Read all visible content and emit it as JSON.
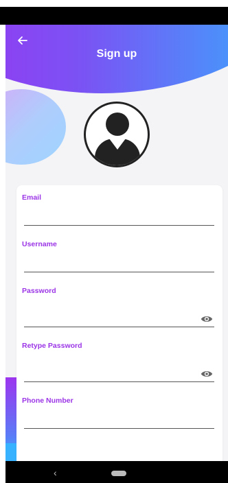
{
  "header": {
    "title": "Sign up",
    "back_icon": "arrow-left-icon"
  },
  "form": {
    "fields": [
      {
        "label": "Email",
        "value": "",
        "type": "email"
      },
      {
        "label": "Username",
        "value": "",
        "type": "text"
      },
      {
        "label": "Password",
        "value": "",
        "type": "password",
        "icon": "eye-icon"
      },
      {
        "label": "Retype Password",
        "value": "",
        "type": "password",
        "icon": "eye-icon"
      },
      {
        "label": "Phone Number",
        "value": "",
        "type": "tel"
      }
    ]
  },
  "nav": {
    "back_glyph": "‹"
  },
  "colors": {
    "accent_purple": "#9b34e6",
    "gradient_start": "#a32cf0",
    "gradient_end": "#2fb6ff"
  }
}
